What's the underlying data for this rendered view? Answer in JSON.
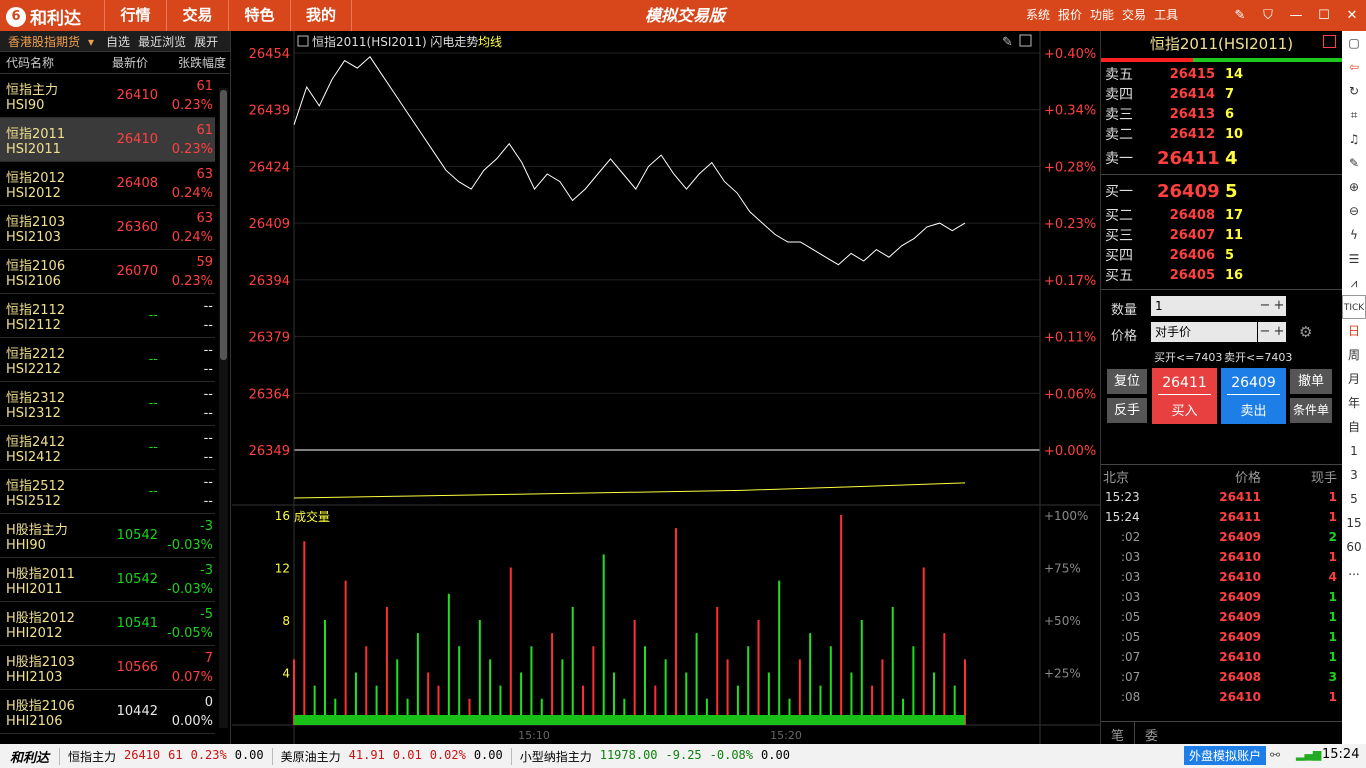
{
  "topbar": {
    "logo": "和利达",
    "logo_mark": "6",
    "nav": [
      "行情",
      "交易",
      "特色",
      "我的"
    ],
    "title": "模拟交易版",
    "menu": [
      "系统",
      "报价",
      "功能",
      "交易",
      "工具"
    ],
    "window_controls": [
      "edit-icon",
      "shirt-icon",
      "minimize-icon",
      "maximize-icon",
      "close-icon"
    ]
  },
  "left": {
    "tabs": [
      "香港股指期货",
      "自选",
      "最近浏览",
      "展开"
    ],
    "headers": [
      "代码名称",
      "最新价",
      "张跌幅度"
    ],
    "rows": [
      {
        "name": "恒指主力",
        "code": "HSI90",
        "price": "26410",
        "change": "61",
        "pct": "0.23%",
        "color": "red"
      },
      {
        "name": "恒指2011",
        "code": "HSI2011",
        "price": "26410",
        "change": "61",
        "pct": "0.23%",
        "color": "red"
      },
      {
        "name": "恒指2012",
        "code": "HSI2012",
        "price": "26408",
        "change": "63",
        "pct": "0.24%",
        "color": "red"
      },
      {
        "name": "恒指2103",
        "code": "HSI2103",
        "price": "26360",
        "change": "63",
        "pct": "0.24%",
        "color": "red"
      },
      {
        "name": "恒指2106",
        "code": "HSI2106",
        "price": "26070",
        "change": "59",
        "pct": "0.23%",
        "color": "red"
      },
      {
        "name": "恒指2112",
        "code": "HSI2112",
        "price": "--",
        "change": "--",
        "pct": "--",
        "color": "green"
      },
      {
        "name": "恒指2212",
        "code": "HSI2212",
        "price": "--",
        "change": "--",
        "pct": "--",
        "color": "green"
      },
      {
        "name": "恒指2312",
        "code": "HSI2312",
        "price": "--",
        "change": "--",
        "pct": "--",
        "color": "green"
      },
      {
        "name": "恒指2412",
        "code": "HSI2412",
        "price": "--",
        "change": "--",
        "pct": "--",
        "color": "green"
      },
      {
        "name": "恒指2512",
        "code": "HSI2512",
        "price": "--",
        "change": "--",
        "pct": "--",
        "color": "green"
      },
      {
        "name": "H股指主力",
        "code": "HHI90",
        "price": "10542",
        "change": "-3",
        "pct": "-0.03%",
        "color": "green"
      },
      {
        "name": "H股指2011",
        "code": "HHI2011",
        "price": "10542",
        "change": "-3",
        "pct": "-0.03%",
        "color": "green"
      },
      {
        "name": "H股指2012",
        "code": "HHI2012",
        "price": "10541",
        "change": "-5",
        "pct": "-0.05%",
        "color": "green"
      },
      {
        "name": "H股指2103",
        "code": "HHI2103",
        "price": "10566",
        "change": "7",
        "pct": "0.07%",
        "color": "red"
      },
      {
        "name": "H股指2106",
        "code": "HHI2106",
        "price": "10442",
        "change": "0",
        "pct": "0.00%",
        "color": "white"
      }
    ]
  },
  "chart": {
    "header": "恒指2011(HSI2011) 闪电走势",
    "avg_label": "均线",
    "volume_label": "成交量",
    "x_ticks": [
      "15:10",
      "15:20"
    ]
  },
  "chart_data": {
    "type": "line",
    "series": [
      {
        "name": "",
        "values": [
          26435,
          26445,
          26440,
          26447,
          26452,
          26450,
          26453,
          26448,
          26443,
          26438,
          26433,
          26428,
          26423,
          26420,
          26418,
          26423,
          26426,
          26430,
          26425,
          26418,
          26422,
          26420,
          26415,
          26418,
          26422,
          26426,
          26422,
          26418,
          26424,
          26427,
          26422,
          26418,
          26422,
          26425,
          26420,
          26417,
          26412,
          26409,
          26406,
          26404,
          26404,
          26402,
          26400,
          26398,
          26401,
          26399,
          26402,
          26400,
          26403,
          26405,
          26408,
          26409,
          26407,
          26409
        ]
      },
      {
        "name": "均线",
        "values": [
          26349,
          26349.5,
          26350,
          26350.5,
          26351,
          26352,
          26353
        ]
      }
    ],
    "y_left": {
      "min": 26349,
      "max": 26454,
      "ticks": [
        26454,
        26439,
        26424,
        26409,
        26394,
        26379,
        26364,
        26349
      ]
    },
    "y_right": [
      "+0.40%",
      "+0.34%",
      "+0.28%",
      "+0.23%",
      "+0.17%",
      "+0.11%",
      "+0.06%",
      "+0.00%"
    ],
    "vol_axis": {
      "left": [
        16,
        12,
        8,
        4
      ],
      "right": [
        "+100%",
        "+75%",
        "+50%",
        "+25%"
      ]
    },
    "volume": [
      5,
      14,
      3,
      8,
      2,
      11,
      4,
      6,
      3,
      9,
      5,
      2,
      7,
      4,
      3,
      10,
      6,
      2,
      8,
      5,
      3,
      12,
      4,
      6,
      2,
      7,
      5,
      9,
      3,
      6,
      13,
      4,
      2,
      8,
      6,
      3,
      5,
      15,
      4,
      7,
      2,
      9,
      5,
      3,
      6,
      8,
      4,
      11,
      2,
      5,
      7,
      3,
      6,
      16,
      4,
      8,
      3,
      5,
      9,
      2,
      6,
      12,
      4,
      7,
      3,
      5
    ]
  },
  "right": {
    "title": "恒指2011(HSI2011)",
    "asks": [
      {
        "label": "卖五",
        "price": "26415",
        "vol": "14"
      },
      {
        "label": "卖四",
        "price": "26414",
        "vol": "7"
      },
      {
        "label": "卖三",
        "price": "26413",
        "vol": "6"
      },
      {
        "label": "卖二",
        "price": "26412",
        "vol": "10"
      },
      {
        "label": "卖一",
        "price": "26411",
        "vol": "4"
      }
    ],
    "bids": [
      {
        "label": "买一",
        "price": "26409",
        "vol": "5"
      },
      {
        "label": "买二",
        "price": "26408",
        "vol": "17"
      },
      {
        "label": "买三",
        "price": "26407",
        "vol": "11"
      },
      {
        "label": "买四",
        "price": "26406",
        "vol": "5"
      },
      {
        "label": "买五",
        "price": "26405",
        "vol": "16"
      }
    ],
    "qty_label": "数量",
    "qty_value": "1",
    "price_label": "价格",
    "price_value": "对手价",
    "buy_limit": "买开<=7403",
    "sell_limit": "卖开<=7403",
    "btn_reset": "复位",
    "btn_reverse": "反手",
    "buy_price": "26411",
    "buy_label": "买入",
    "sell_price": "26409",
    "sell_label": "卖出",
    "btn_cancel": "撤单",
    "btn_condition": "条件单",
    "ticks_header": [
      "北京",
      "价格",
      "现手"
    ],
    "ticks": [
      {
        "t": "15:23",
        "p": "26411",
        "v": "1",
        "c": "red"
      },
      {
        "t": "15:24",
        "p": "26411",
        "v": "1",
        "c": "red"
      },
      {
        "t": ":02",
        "p": "26409",
        "v": "2",
        "c": "green"
      },
      {
        "t": ":03",
        "p": "26410",
        "v": "1",
        "c": "red"
      },
      {
        "t": ":03",
        "p": "26410",
        "v": "4",
        "c": "red"
      },
      {
        "t": ":03",
        "p": "26409",
        "v": "1",
        "c": "green"
      },
      {
        "t": ":05",
        "p": "26409",
        "v": "1",
        "c": "green"
      },
      {
        "t": ":05",
        "p": "26409",
        "v": "1",
        "c": "green"
      },
      {
        "t": ":07",
        "p": "26410",
        "v": "1",
        "c": "green"
      },
      {
        "t": ":07",
        "p": "26408",
        "v": "3",
        "c": "green"
      },
      {
        "t": ":08",
        "p": "26410",
        "v": "1",
        "c": "red"
      }
    ],
    "tabs": [
      "笔",
      "委"
    ]
  },
  "sidebar": [
    "square-icon",
    "back-icon",
    "refresh-icon",
    "crop-icon",
    "bell-icon",
    "pencil-icon",
    "zoom-in-icon",
    "zoom-out-icon",
    "lightning-icon",
    "list-icon",
    "chart-icon",
    "TICK",
    "日",
    "周",
    "月",
    "年",
    "自",
    "1",
    "3",
    "5",
    "15",
    "60",
    "..."
  ],
  "status": {
    "logo": "和利达",
    "items": [
      {
        "name": "恒指主力",
        "price": "26410",
        "chg": "61",
        "pct": "0.23%",
        "vol": "0.00",
        "color": "red"
      },
      {
        "name": "美原油主力",
        "price": "41.91",
        "chg": "0.01",
        "pct": "0.02%",
        "vol": "0.00",
        "color": "red"
      },
      {
        "name": "小型纳指主力",
        "price": "11978.00",
        "chg": "-9.25",
        "pct": "-0.08%",
        "vol": "0.00",
        "color": "green"
      }
    ],
    "account": "外盘模拟账户",
    "time": "15:24"
  }
}
